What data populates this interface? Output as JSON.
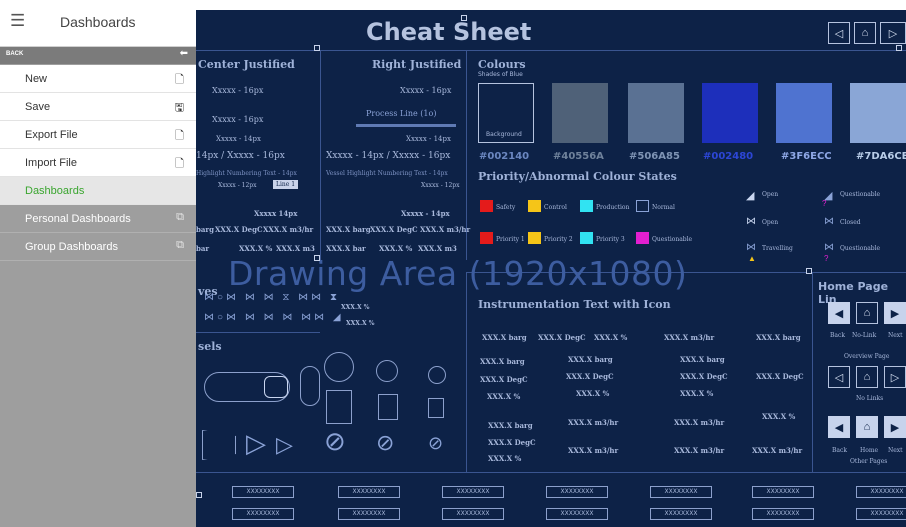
{
  "sidebar": {
    "title": "Dashboards",
    "back_label": "BACK",
    "items": [
      {
        "label": "New",
        "icon": "new-file-icon"
      },
      {
        "label": "Save",
        "icon": "save-icon"
      },
      {
        "label": "Export File",
        "icon": "export-file-icon"
      },
      {
        "label": "Import File",
        "icon": "import-file-icon"
      },
      {
        "label": "Dashboards",
        "icon": ""
      },
      {
        "label": "Personal Dashboards",
        "icon": "dashboard-icon"
      },
      {
        "label": "Group Dashboards",
        "icon": "dashboard-icon"
      }
    ]
  },
  "canvas": {
    "title": "Cheat Sheet",
    "drawing_area": "Drawing Area (1920x1080)",
    "center_justified": {
      "heading": "Center Justified",
      "l1": "Xxxxx - 16px",
      "l2": "Xxxxx - 16px",
      "l3": "Xxxxx - 14px",
      "l4": "14px  /  Xxxxx - 16px",
      "l5": "Highlight Numbering Text - 14px",
      "l6": "Xxxxx - 12px",
      "l6b": "Line 1",
      "l7": "Xxxxx  14px",
      "l8a": "barg",
      "l8b": "XXX.X DegC",
      "l8c": "XXX.X m3/hr",
      "l9a": "bar",
      "l9b": "XXX.X %",
      "l9c": "XXX.X m3"
    },
    "right_justified": {
      "heading": "Right Justified",
      "l1": "Xxxxx - 16px",
      "process_line": "Process Line (1o)",
      "l3": "Xxxxx - 14px",
      "l4": "Xxxxx - 14px  /  Xxxxx - 16px",
      "l5": "Vessel Highlight Numbering Text - 14px",
      "l6": "Xxxxx - 12px",
      "l7": "Xxxxx - 14px",
      "l8a": "XXX.X barg",
      "l8b": "XXX.X DegC",
      "l8c": "XXX.X m3/hr",
      "l9a": "XXX.X bar",
      "l9b": "XXX.X %",
      "l9c": "XXX.X m3"
    },
    "colours": {
      "heading": "Colours",
      "subheading": "Shades of Blue",
      "bg_label": "Background",
      "swatches": [
        {
          "hex": "#002140",
          "label": "#002140"
        },
        {
          "hex": "#40556A",
          "label": "#40556A"
        },
        {
          "hex": "#506A85",
          "label": "#506A85"
        },
        {
          "hex": "#002480",
          "label": "#002480"
        },
        {
          "hex": "#3F6ECC",
          "label": "#3F6ECC"
        },
        {
          "hex": "#7DA6CE",
          "label": "#7DA6CE"
        }
      ]
    },
    "priority": {
      "heading": "Priority/Abnormal Colour States",
      "safety": "Safety",
      "control": "Control",
      "production": "Production",
      "normal": "Normal",
      "priority1": "Priority 1",
      "priority2": "Priority 2",
      "priority3": "Priority 3",
      "questionable": "Questionable",
      "colors": {
        "safety": "#e41b1b",
        "control": "#f5c518",
        "production": "#31e3f2",
        "questionable": "#e21fd0"
      }
    },
    "states": {
      "open": "Open",
      "questionable": "Questionable",
      "open2": "Open",
      "closed": "Closed",
      "travelling": "Travelling",
      "questionable2": "Questionable",
      "questionable_color": "#e21fd0",
      "travelling_color": "#f5c518"
    },
    "valves": {
      "heading": "ves",
      "v1": "XXX.X %",
      "v2": "XXX.X %"
    },
    "vessels": {
      "heading": "sels"
    },
    "instrumentation": {
      "heading": "Instrumentation Text with Icon",
      "r1": [
        "XXX.X barg",
        "XXX.X DegC",
        "XXX.X %",
        "XXX.X m3/hr",
        "XXX.X barg"
      ],
      "c1": [
        "XXX.X barg",
        "XXX.X DegC",
        "XXX.X %",
        "XXX.X barg",
        "XXX.X DegC",
        "XXX.X %"
      ],
      "c2": [
        "XXX.X barg",
        "XXX.X DegC",
        "XXX.X %",
        "XXX.X m3/hr",
        "XXX.X m3/hr"
      ],
      "c3": [
        "XXX.X barg",
        "XXX.X DegC",
        "XXX.X %",
        "XXX.X m3/hr",
        "XXX.X m3/hr"
      ],
      "c4": [
        "XXX.X DegC",
        "XXX.X %",
        "XXX.X m3/hr"
      ]
    },
    "home_links": {
      "heading": "Home Page Lin",
      "back": "Back",
      "no_link": "No-Link",
      "next": "Next",
      "overview": "Overview Page",
      "no_links": "No Links",
      "back2": "Back",
      "home": "Home",
      "next2": "Next",
      "other_pages": "Other Pages"
    },
    "bars": {
      "label": "XXXXXXXX"
    }
  }
}
